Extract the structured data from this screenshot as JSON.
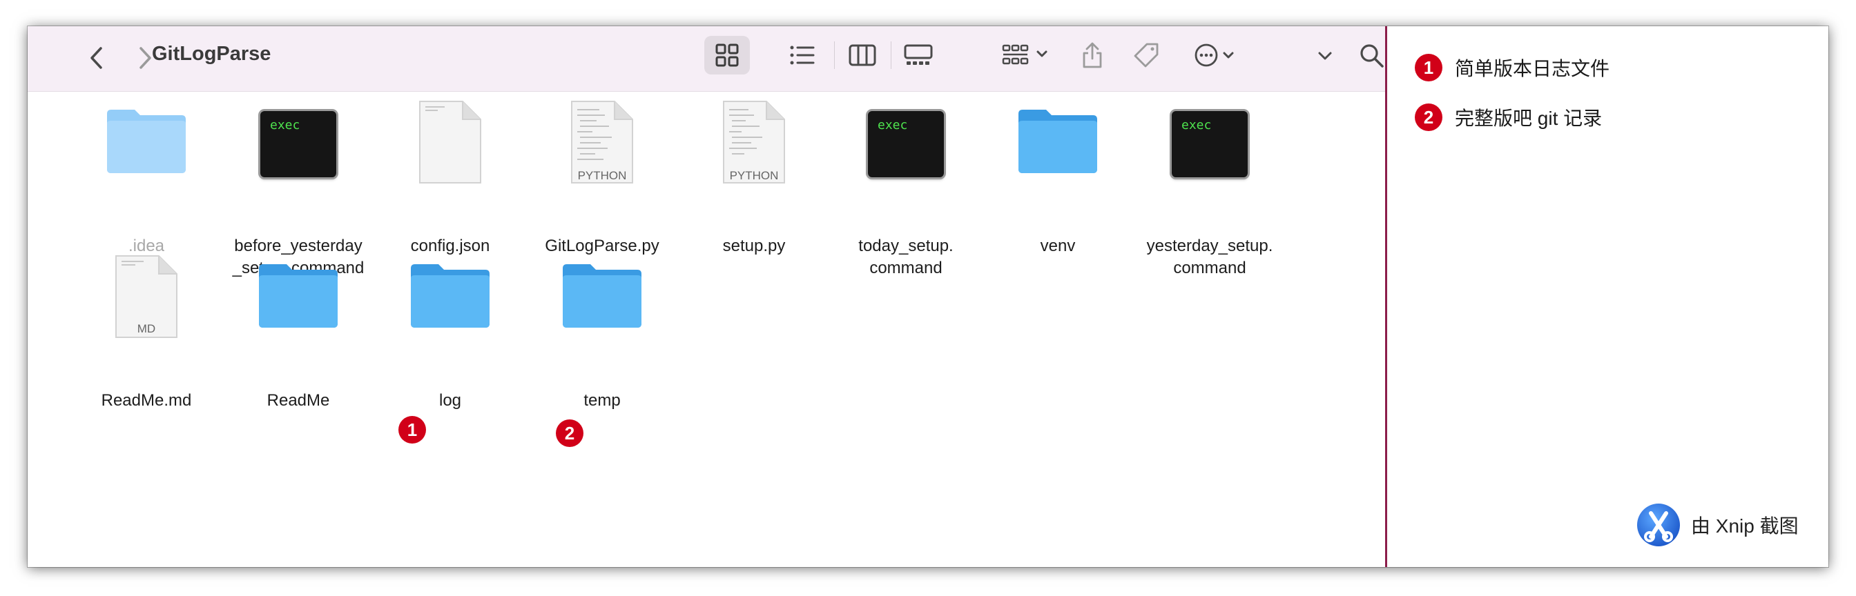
{
  "window": {
    "title": "GitLogParse"
  },
  "toolbar": {
    "back": "back-icon",
    "forward": "forward-icon",
    "views": [
      "icon-view",
      "list-view",
      "column-view",
      "gallery-view"
    ],
    "group": "group-icon",
    "share": "share-icon",
    "tags": "tag-icon",
    "more": "more-icon",
    "search": "search-icon"
  },
  "items": [
    {
      "name": ".idea",
      "kind": "folder-light"
    },
    {
      "name": "before_yesterday",
      "name2": "_setup. command",
      "kind": "exec",
      "badge_text": "exec"
    },
    {
      "name": "config.json",
      "kind": "doc"
    },
    {
      "name": "GitLogParse.py",
      "kind": "doc",
      "badge_text": "PYTHON"
    },
    {
      "name": "setup.py",
      "kind": "doc",
      "badge_text": "PYTHON"
    },
    {
      "name": "today_setup.",
      "name2": "command",
      "kind": "exec",
      "badge_text": "exec"
    },
    {
      "name": "venv",
      "kind": "folder"
    },
    {
      "name": "yesterday_setup.",
      "name2": "command",
      "kind": "exec",
      "badge_text": "exec"
    },
    {
      "name": "ReadMe.md",
      "kind": "doc",
      "badge_text": "MD"
    },
    {
      "name": "ReadMe",
      "kind": "folder"
    },
    {
      "name": "log",
      "kind": "folder",
      "marker": "1"
    },
    {
      "name": "temp",
      "kind": "folder",
      "marker": "2"
    }
  ],
  "notes": [
    {
      "marker": "1",
      "text": "简单版本日志文件"
    },
    {
      "marker": "2",
      "text": "完整版吧 git 记录"
    }
  ],
  "brand": {
    "text": "由 Xnip 截图"
  },
  "colors": {
    "toolbar_bg": "#f6eef6",
    "folder": "#5bb8f5",
    "folder_light": "#a9d8fb",
    "marker": "#d10018",
    "exec_text": "#4ee34e",
    "accent_line": "#8c1d4a"
  }
}
